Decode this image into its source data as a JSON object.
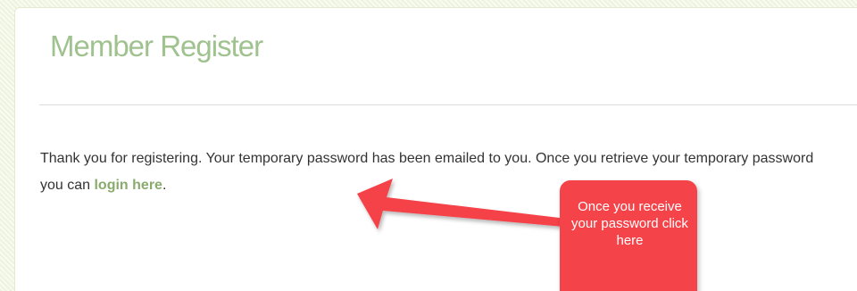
{
  "page": {
    "title": "Member Register"
  },
  "message": {
    "text_before_link": "Thank you for registering. Your temporary password has been emailed to you. Once you retrieve your temporary password you can ",
    "link_label": "login here",
    "text_after_link": "."
  },
  "annotation": {
    "callout_text": "Once you receive your password click here",
    "color": "#f5434a"
  },
  "colors": {
    "title": "#9fc28f",
    "link": "#8aab6e",
    "body_text": "#333333"
  }
}
